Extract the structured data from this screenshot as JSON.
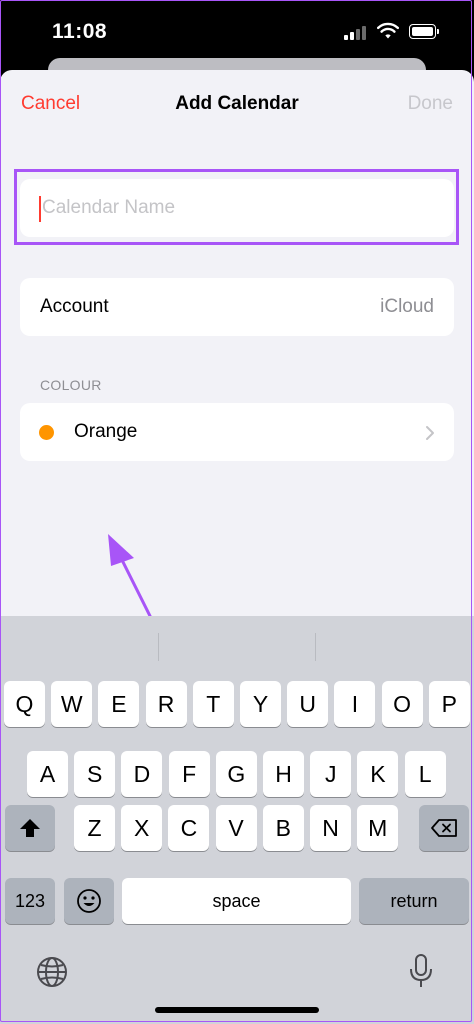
{
  "status_bar": {
    "time": "11:08",
    "icons": [
      "signal-icon",
      "wifi-icon",
      "battery-icon"
    ]
  },
  "nav": {
    "cancel": "Cancel",
    "title": "Add Calendar",
    "done": "Done"
  },
  "form": {
    "name_value": "",
    "name_placeholder": "Calendar Name",
    "account_label": "Account",
    "account_value": "iCloud",
    "colour_header": "COLOUR",
    "colour_value": "Orange",
    "colour_swatch": "#ff9500"
  },
  "colors": {
    "accent": "#ff3b30",
    "annotation": "#a855f7"
  },
  "keyboard": {
    "row1": [
      "Q",
      "W",
      "E",
      "R",
      "T",
      "Y",
      "U",
      "I",
      "O",
      "P"
    ],
    "row2": [
      "A",
      "S",
      "D",
      "F",
      "G",
      "H",
      "J",
      "K",
      "L"
    ],
    "row3": [
      "Z",
      "X",
      "C",
      "V",
      "B",
      "N",
      "M"
    ],
    "numbers_key": "123",
    "space_key": "space",
    "return_key": "return"
  }
}
